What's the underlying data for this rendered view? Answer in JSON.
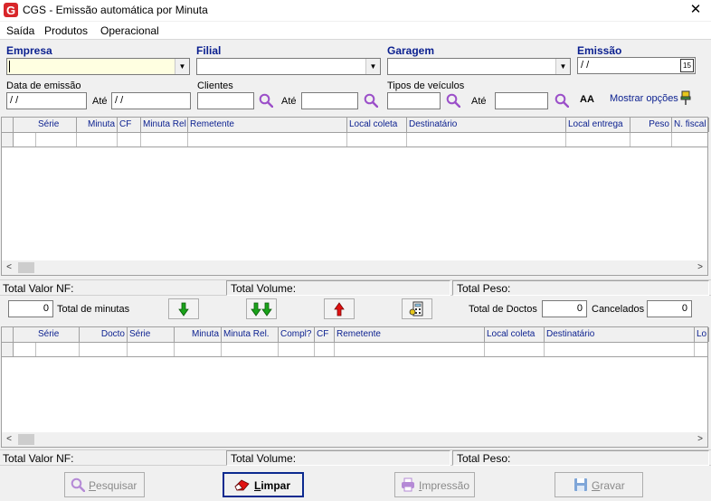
{
  "window": {
    "title": "CGS - Emissão automática por Minuta",
    "close_glyph": "✕"
  },
  "menu": [
    {
      "label": "Saída"
    },
    {
      "label": "Produtos"
    },
    {
      "label": "Operacional"
    }
  ],
  "filters": {
    "empresa_label": "Empresa",
    "empresa_value": "",
    "filial_label": "Filial",
    "filial_value": "",
    "garagem_label": "Garagem",
    "garagem_value": "",
    "emissao_label": "Emissão",
    "emissao_value": " / /",
    "calendar_glyph": "15",
    "data_emissao_label": "Data de emissão",
    "data_de_value": " / /",
    "ate_label": "Até",
    "data_ate_value": " / /",
    "clientes_label": "Clientes",
    "clientes_de_value": "",
    "clientes_ate_label": "Até",
    "clientes_ate_value": "",
    "tipos_label": "Tipos de veículos",
    "tipos_de_value": "",
    "tipos_ate_label": "Até",
    "tipos_ate_value": "",
    "font_glyph": "AA",
    "mostrar_opcoes_label": "Mostrar opções"
  },
  "grid1": {
    "columns": [
      "Série",
      "Minuta",
      "CF",
      "Minuta Rel",
      "Remetente",
      "Local coleta",
      "Destinatário",
      "Local entrega",
      "Peso",
      "N. fiscal"
    ]
  },
  "totals1": {
    "valor_nf": "Total Valor NF:",
    "volume": "Total Volume:",
    "peso": "Total Peso:"
  },
  "actions": {
    "total_minutas_value": "0",
    "total_minutas_label": "Total de minutas",
    "total_doctos_label": "Total de Doctos",
    "total_doctos_value": "0",
    "cancelados_label": "Cancelados",
    "cancelados_value": "0"
  },
  "grid2": {
    "columns": [
      "Série",
      "Docto",
      "Série",
      "Minuta",
      "Minuta Rel.",
      "Compl?",
      "CF",
      "Remetente",
      "Local coleta",
      "Destinatário",
      "Lo"
    ]
  },
  "totals2": {
    "valor_nf": "Total Valor NF:",
    "volume": "Total Volume:",
    "peso": "Total Peso:"
  },
  "buttons": {
    "pesquisar": "Pesquisar",
    "limpar": "Limpar",
    "impressao": "Impressão",
    "gravar": "Gravar"
  },
  "colors": {
    "label_blue": "#0a1f8f",
    "highlight_yellow": "#ffffe1",
    "search_purple": "#9b4fc9",
    "arrow_green": "#1aa31a",
    "arrow_red": "#e01010"
  }
}
